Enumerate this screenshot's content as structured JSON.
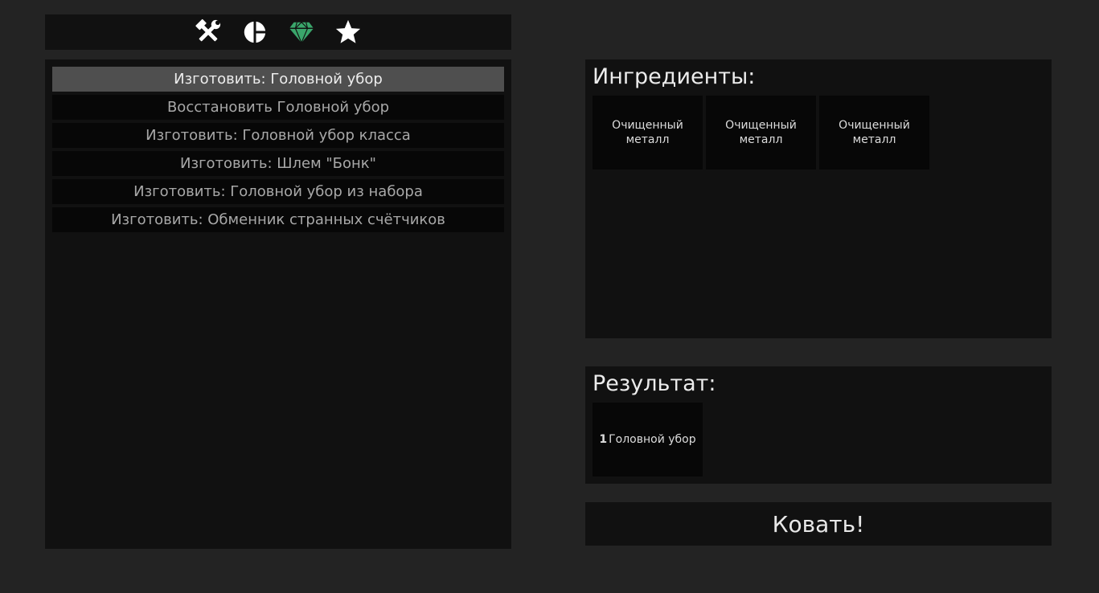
{
  "tabs": [
    {
      "icon": "hammer-wrench-icon",
      "color": "#ffffff"
    },
    {
      "icon": "pie-chart-icon",
      "color": "#ffffff"
    },
    {
      "icon": "gem-icon",
      "color": "#3aa66b"
    },
    {
      "icon": "star-icon",
      "color": "#ffffff"
    }
  ],
  "recipes": [
    {
      "label": "Изготовить: Головной убор",
      "selected": true
    },
    {
      "label": "Восстановить Головной убор",
      "selected": false
    },
    {
      "label": "Изготовить: Головной убор класса",
      "selected": false
    },
    {
      "label": "Изготовить: Шлем \"Бонк\"",
      "selected": false
    },
    {
      "label": "Изготовить: Головной убор из набора",
      "selected": false
    },
    {
      "label": "Изготовить: Обменник странных счётчиков",
      "selected": false
    }
  ],
  "ingredients": {
    "title": "Ингредиенты:",
    "items": [
      {
        "name": "Очищенный металл"
      },
      {
        "name": "Очищенный металл"
      },
      {
        "name": "Очищенный металл"
      }
    ]
  },
  "result": {
    "title": "Результат:",
    "items": [
      {
        "qty": "1",
        "name": "Головной убор"
      }
    ]
  },
  "forge_button": {
    "label": "Ковать!"
  },
  "colors": {
    "background": "#232323",
    "panel": "#111111",
    "slot": "#070707",
    "selected_row": "#4f4f4f",
    "accent_gem": "#3aa66b"
  }
}
